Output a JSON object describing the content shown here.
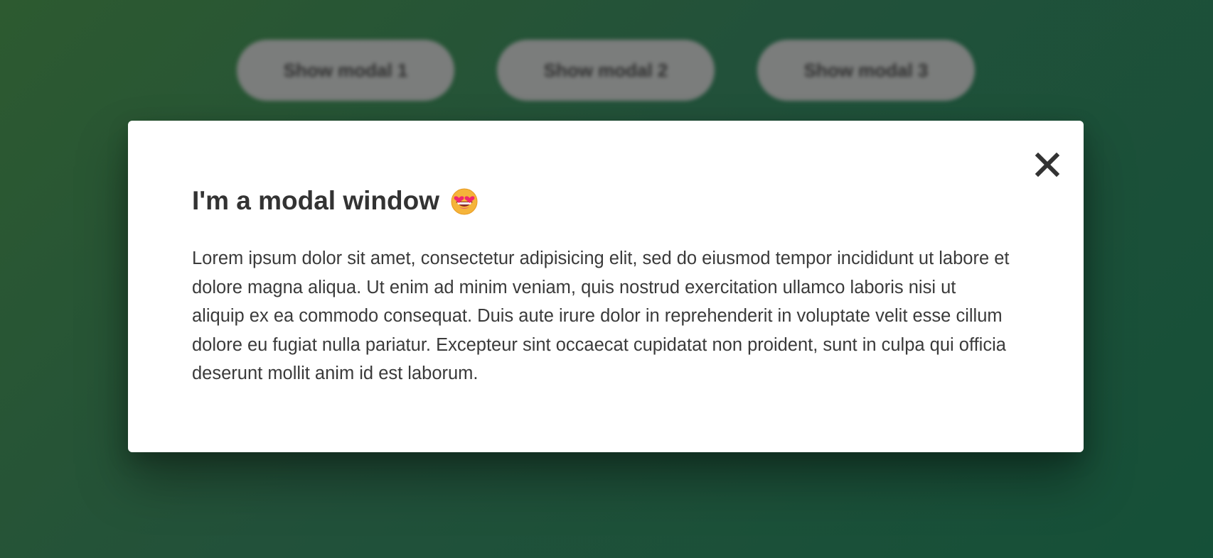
{
  "buttons": [
    {
      "label": "Show modal 1"
    },
    {
      "label": "Show modal 2"
    },
    {
      "label": "Show modal 3"
    }
  ],
  "modal": {
    "title": "I'm a modal window",
    "title_emoji": "smiling-face-with-heart-eyes-icon",
    "close_icon": "close-icon",
    "body": "Lorem ipsum dolor sit amet, consectetur adipisicing elit, sed do eiusmod tempor incididunt ut labore et dolore magna aliqua. Ut enim ad minim veniam, quis nostrud exercitation ullamco laboris nisi ut aliquip ex ea commodo consequat. Duis aute irure dolor in reprehenderit in voluptate velit esse cillum dolore eu fugiat nulla pariatur. Excepteur sint occaecat cupidatat non proident, sunt in culpa qui officia deserunt mollit anim id est laborum."
  },
  "colors": {
    "background_start": "#2d5a30",
    "background_end": "#155038",
    "button_bg": "#7b7d7c",
    "modal_bg": "#ffffff",
    "text": "#333333"
  }
}
